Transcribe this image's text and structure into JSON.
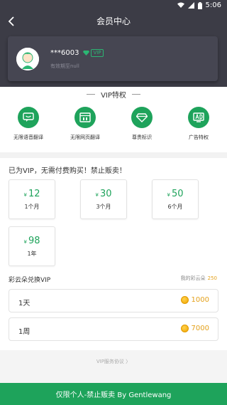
{
  "statusbar": {
    "time": "5:06"
  },
  "header": {
    "title": "会员中心"
  },
  "user": {
    "name": "***6003",
    "vip_tag": "VIP",
    "expiry": "有效期至null"
  },
  "vip_section": {
    "title": "VIP特权"
  },
  "features": [
    {
      "label": "无限语音翻译",
      "icon": "chat-bubble-icon"
    },
    {
      "label": "无限网页翻译",
      "icon": "web-page-icon"
    },
    {
      "label": "尊贵标识",
      "icon": "diamond-icon"
    },
    {
      "label": "广告特权",
      "icon": "ad-icon"
    }
  ],
  "notice": "已为VIP，无需付费购买！禁止贩卖！",
  "prices": [
    {
      "symbol": "¥",
      "amount": "12",
      "duration": "1个月"
    },
    {
      "symbol": "¥",
      "amount": "30",
      "duration": "3个月"
    },
    {
      "symbol": "¥",
      "amount": "50",
      "duration": "6个月"
    },
    {
      "symbol": "¥",
      "amount": "98",
      "duration": "1年"
    }
  ],
  "exchange": {
    "title": "彩云朵兑换VIP",
    "balance_label": "我的彩云朵",
    "balance": "250",
    "options": [
      {
        "duration": "1天",
        "cost": "1000"
      },
      {
        "duration": "1周",
        "cost": "7000"
      }
    ]
  },
  "agreement": "VIP服务协议 〉",
  "footer": "仅限个人-禁止贩卖 By Gentlewang",
  "colors": {
    "primary_green": "#1ea35b",
    "header_bg": "#3c3c46",
    "coin_gold": "#e4a11b"
  }
}
